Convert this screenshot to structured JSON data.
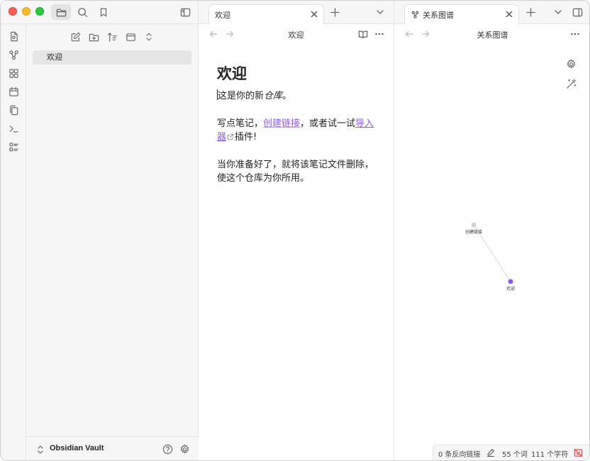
{
  "colors": {
    "accent": "#8a5cf5",
    "close_red": "#fe5f57",
    "minimize_yellow": "#febc2e",
    "zoom_green": "#28c840",
    "sync_error": "#e24a4a"
  },
  "left_toolbar": {
    "icons": [
      "folder-icon",
      "search-icon",
      "bookmark-icon",
      "sidebar-toggle-icon"
    ]
  },
  "ribbon": {
    "icons": [
      "note-icon",
      "graph-icon",
      "canvas-icon",
      "calendar-icon",
      "copy-icon",
      "terminal-icon",
      "list-icon"
    ]
  },
  "explorer": {
    "tools": [
      "new-note-icon",
      "new-folder-icon",
      "sort-icon",
      "collapse-icon",
      "expand-icon"
    ],
    "files": [
      {
        "name": "欢迎"
      }
    ],
    "vault_name": "Obsidian Vault"
  },
  "tabs": {
    "note": {
      "label": "欢迎"
    },
    "graph": {
      "label": "关系图谱"
    }
  },
  "note": {
    "header_title": "欢迎",
    "title": "欢迎",
    "p1_prefix": "这是你的新",
    "p1_emph": "仓库",
    "p1_suffix": "。",
    "p2_prefix": "写点笔记，",
    "p2_link": "创建链接",
    "p2_mid": "，或者试一试",
    "p2_ext_link": "导入器",
    "p2_suffix": "插件!",
    "p3": "当你准备好了，就将该笔记文件删除，使这个仓库为你所用。"
  },
  "graph": {
    "header_title": "关系图谱",
    "nodes": [
      {
        "label": "创建链接",
        "state": "unresolved"
      },
      {
        "label": "欢迎",
        "state": "active"
      }
    ]
  },
  "status": {
    "backlinks": "0 条反向链接",
    "words": "55 个词",
    "chars": "111 个字符"
  }
}
